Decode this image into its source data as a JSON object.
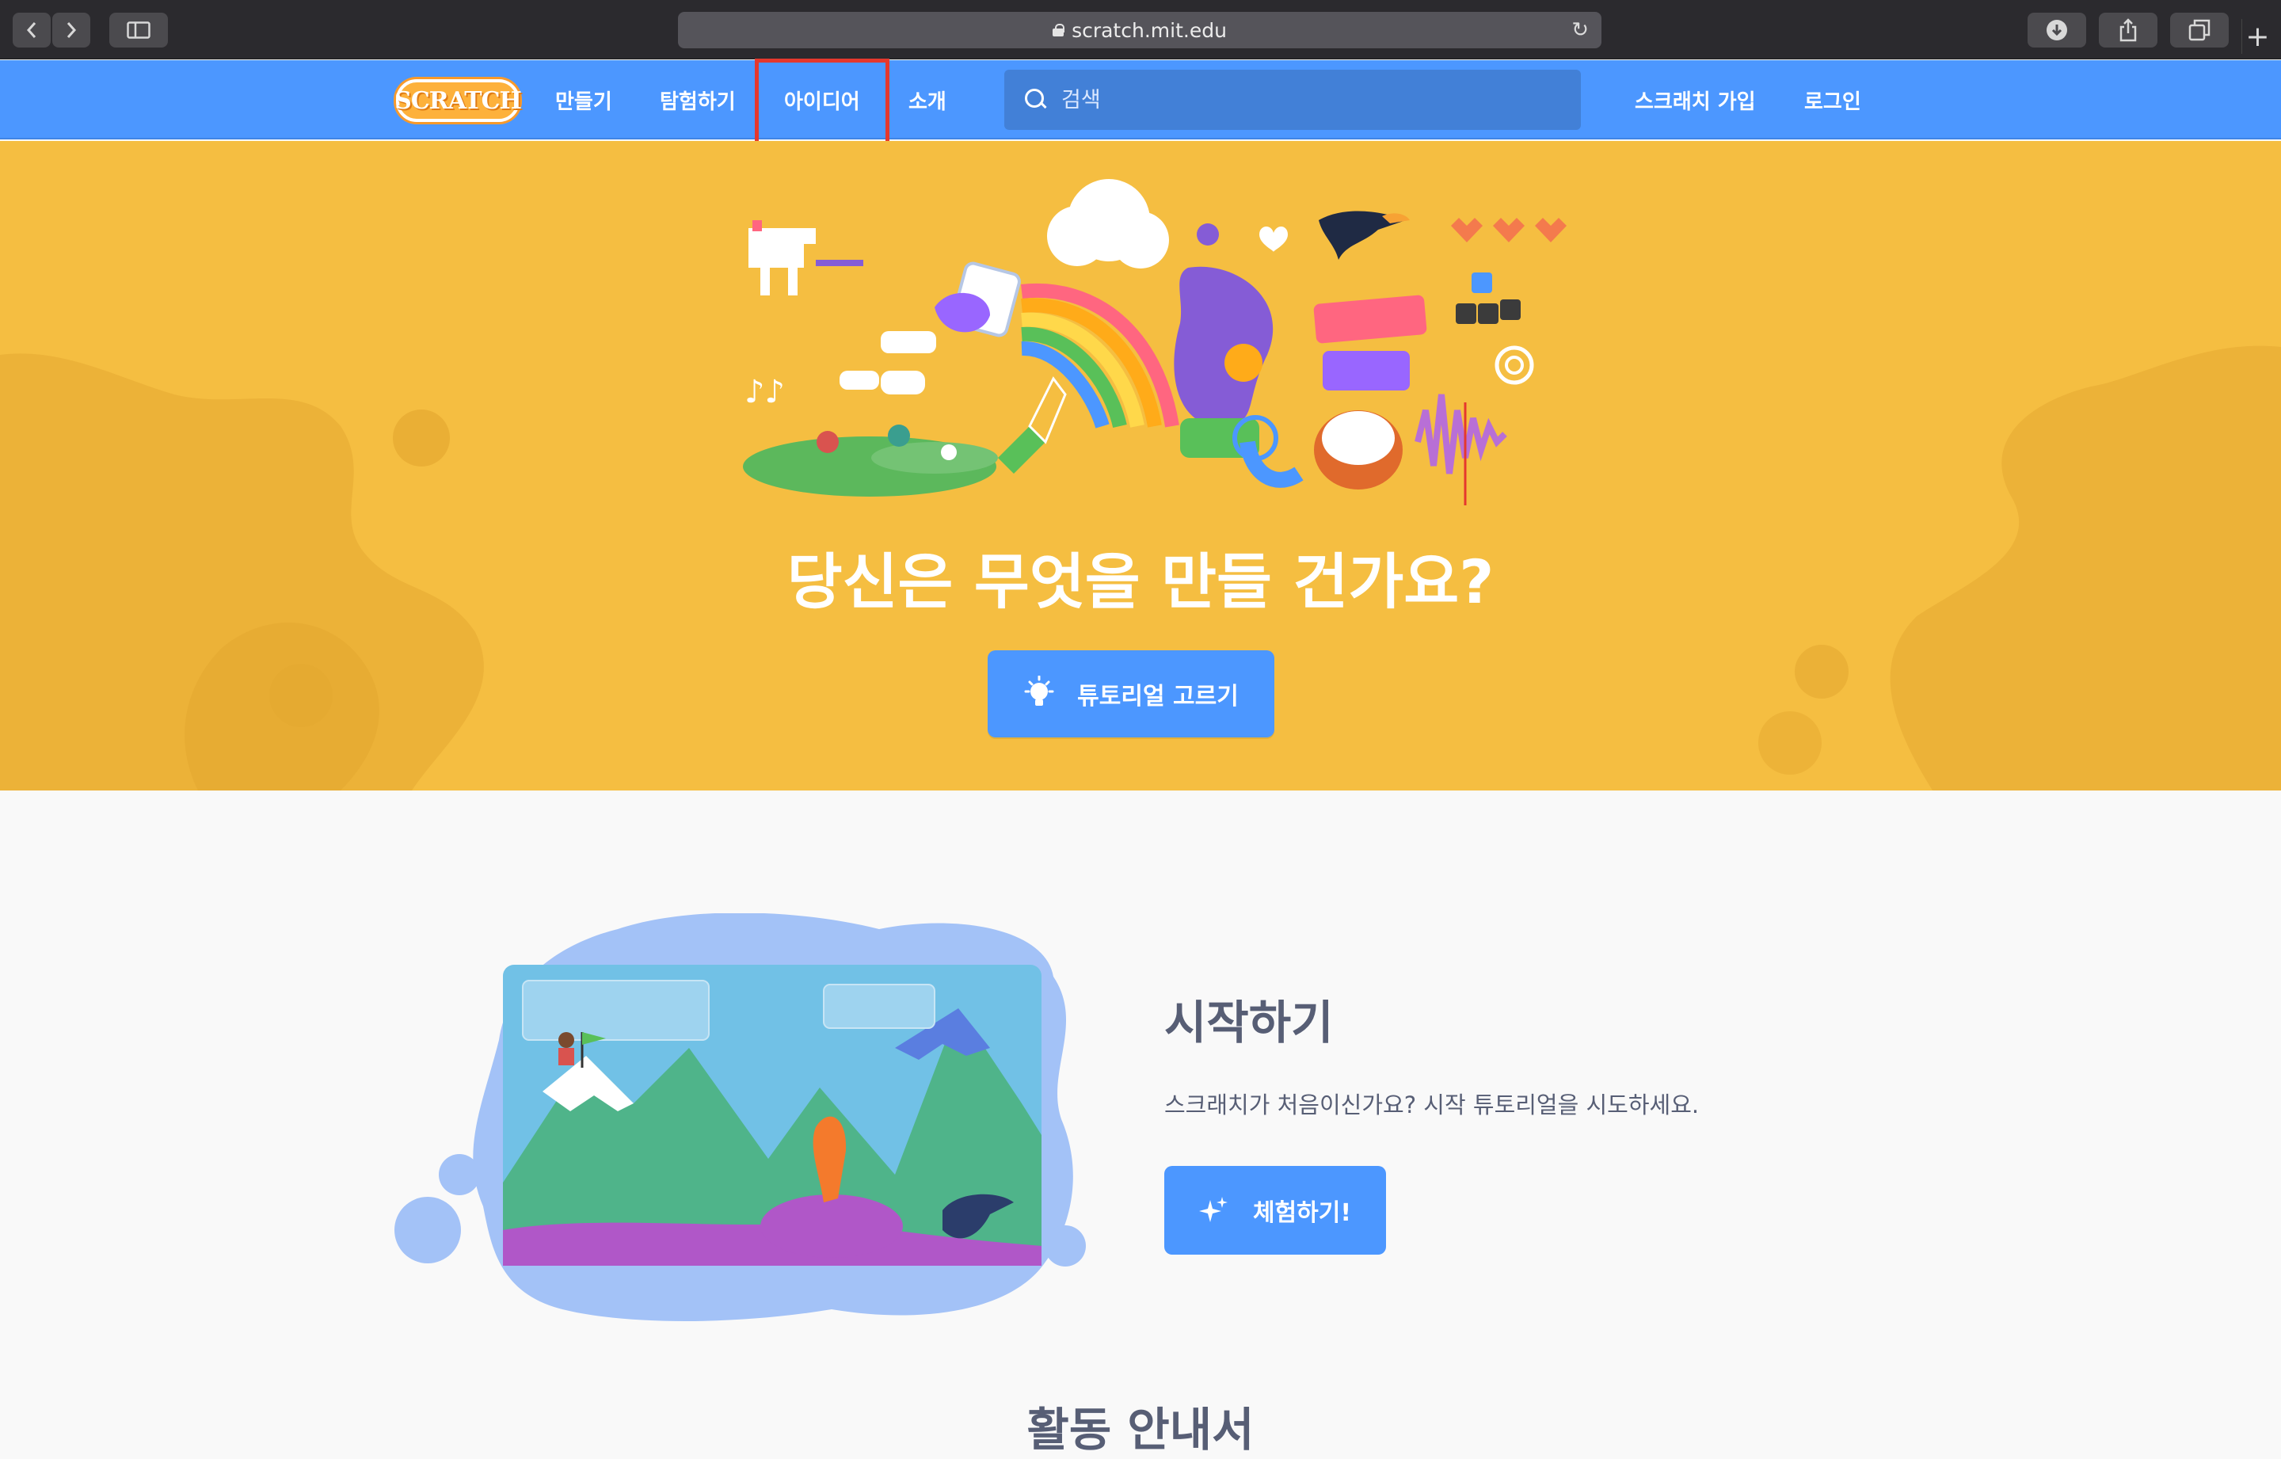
{
  "browser": {
    "url": "scratch.mit.edu"
  },
  "nav": {
    "logo_text": "SCRATCH",
    "links": {
      "create": "만들기",
      "explore": "탐험하기",
      "ideas": "아이디어",
      "about": "소개"
    },
    "search_placeholder": "검색",
    "join": "스크래치 가입",
    "signin": "로그인"
  },
  "hero": {
    "title": "당신은 무엇을 만들 건가요?",
    "tutorial_button": "튜토리얼 고르기"
  },
  "getting_started": {
    "title": "시작하기",
    "description": "스크래치가 처음이신가요? 시작 튜토리얼을 시도하세요.",
    "try_button": "체험하기!"
  },
  "next_section": {
    "title": "활동 안내서"
  },
  "colors": {
    "nav_blue": "#4c97ff",
    "hero_yellow": "#f5be41",
    "highlight_red": "#e5382d",
    "text_gray": "#575e75"
  }
}
